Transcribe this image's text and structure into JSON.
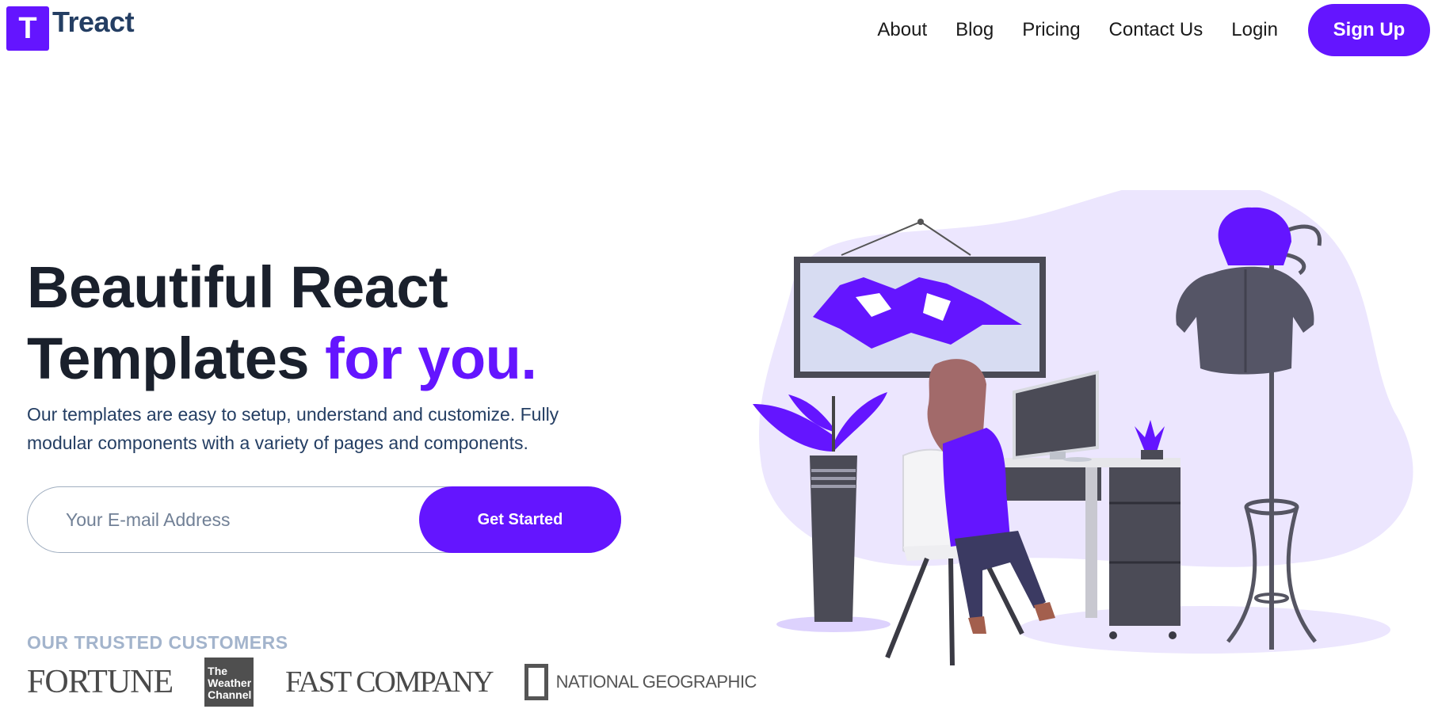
{
  "brand": {
    "logo_letter": "T",
    "name": "Treact"
  },
  "nav": {
    "links": [
      "About",
      "Blog",
      "Pricing",
      "Contact Us",
      "Login"
    ],
    "cta": "Sign Up"
  },
  "hero": {
    "headline_line1": "Beautiful React",
    "headline_line2": "Templates ",
    "headline_accent": "for you.",
    "subtext": "Our templates are easy to setup, understand and customize. Fully modular components with a variety of pages and components.",
    "email_placeholder": "Your E-mail Address",
    "submit_label": "Get Started"
  },
  "customers": {
    "title": "OUR TRUSTED CUSTOMERS",
    "logos": [
      "FORTUNE",
      "The Weather Channel",
      "FAST COMPANY",
      "NATIONAL GEOGRAPHIC"
    ]
  },
  "colors": {
    "accent": "#6415ff",
    "heading": "#1a202c",
    "muted": "#a3b4cc"
  },
  "illustration": {
    "icon": "woman-at-desk-illustration"
  }
}
